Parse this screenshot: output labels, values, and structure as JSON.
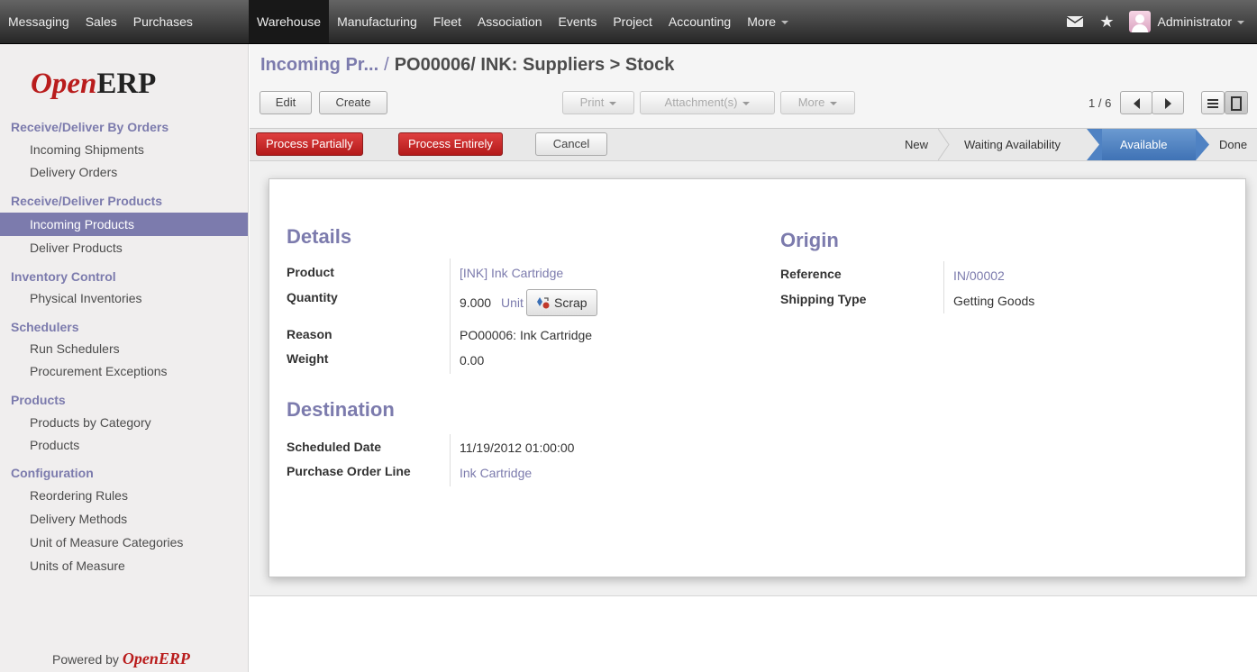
{
  "topbar": {
    "left_menu": [
      "Messaging",
      "Sales",
      "Purchases"
    ],
    "main_menu": [
      "Warehouse",
      "Manufacturing",
      "Fleet",
      "Association",
      "Events",
      "Project",
      "Accounting"
    ],
    "more_label": "More",
    "user": "Administrator"
  },
  "sidebar": {
    "logo_open": "Open",
    "logo_erp": "ERP",
    "sections": [
      {
        "title": "Receive/Deliver By Orders",
        "items": [
          "Incoming Shipments",
          "Delivery Orders"
        ]
      },
      {
        "title": "Receive/Deliver Products",
        "items": [
          "Incoming Products",
          "Deliver Products"
        ]
      },
      {
        "title": "Inventory Control",
        "items": [
          "Physical Inventories"
        ]
      },
      {
        "title": "Schedulers",
        "items": [
          "Run Schedulers",
          "Procurement Exceptions"
        ]
      },
      {
        "title": "Products",
        "items": [
          "Products by Category",
          "Products"
        ]
      },
      {
        "title": "Configuration",
        "items": [
          "Reordering Rules",
          "Delivery Methods",
          "Unit of Measure Categories",
          "Units of Measure"
        ]
      }
    ],
    "active_item": "Incoming Products",
    "powered_by": "Powered by",
    "powered_brand": "OpenERP"
  },
  "header": {
    "breadcrumb_parent": "Incoming Pr...",
    "breadcrumb_sep": "/",
    "breadcrumb_current": "PO00006/ INK: Suppliers > Stock",
    "edit_label": "Edit",
    "create_label": "Create",
    "print_label": "Print",
    "attachments_label": "Attachment(s)",
    "more_label": "More",
    "pager": "1 / 6"
  },
  "statusbar": {
    "process_partially": "Process Partially",
    "process_entirely": "Process Entirely",
    "cancel": "Cancel",
    "stages": [
      "New",
      "Waiting Availability",
      "Available",
      "Done"
    ],
    "current_stage": "Available"
  },
  "form": {
    "details_title": "Details",
    "product_label": "Product",
    "product_value": "[INK] Ink Cartridge",
    "quantity_label": "Quantity",
    "quantity_value": "9.000",
    "quantity_unit": "Unit",
    "scrap_label": "Scrap",
    "reason_label": "Reason",
    "reason_value": "PO00006: Ink Cartridge",
    "weight_label": "Weight",
    "weight_value": "0.00",
    "destination_title": "Destination",
    "scheduled_date_label": "Scheduled Date",
    "scheduled_date_value": "11/19/2012 01:00:00",
    "pol_label": "Purchase Order Line",
    "pol_value": "Ink Cartridge",
    "origin_title": "Origin",
    "reference_label": "Reference",
    "reference_value": "IN/00002",
    "shipping_type_label": "Shipping Type",
    "shipping_type_value": "Getting Goods"
  },
  "colors": {
    "accent": "#7c7bad",
    "brand_red": "#b91c1c",
    "stage_current": "#4f82c3"
  }
}
